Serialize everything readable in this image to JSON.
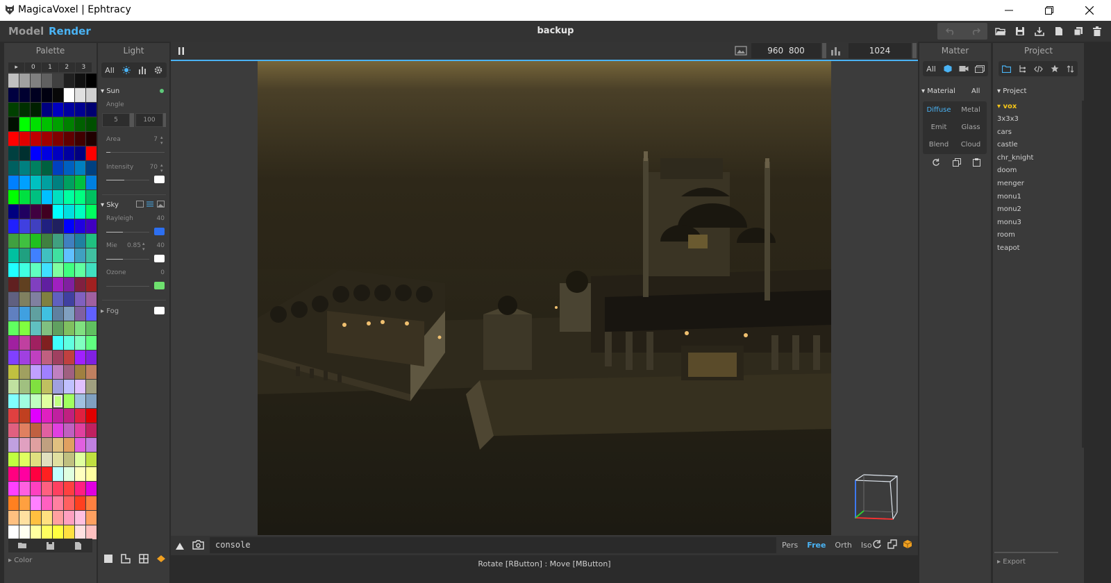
{
  "window": {
    "title": "MagicaVoxel | Ephtracy",
    "minimize_icon": "minimize-icon",
    "restore_icon": "restore-icon",
    "close_icon": "close-icon"
  },
  "menubar": {
    "mode_model": "Model",
    "mode_render": "Render",
    "filename": "backup"
  },
  "palette": {
    "title": "Palette",
    "tabs": [
      "▸",
      "0",
      "1",
      "2",
      "3"
    ],
    "colors": [
      "#c0c0c0",
      "#a0a0a0",
      "#808080",
      "#606060",
      "#404040",
      "#202020",
      "#101010",
      "#000000",
      "#000040",
      "#000030",
      "#000020",
      "#000010",
      "#080808",
      "#ffffff",
      "#e0e0e0",
      "#d0d0d0",
      "#004000",
      "#003000",
      "#002000",
      "#000080",
      "#0000c0",
      "#0000a0",
      "#000090",
      "#000070",
      "#001000",
      "#00ff00",
      "#00e000",
      "#00c000",
      "#00a000",
      "#008000",
      "#006000",
      "#005000",
      "#ff0000",
      "#e00000",
      "#c00000",
      "#a00000",
      "#800000",
      "#600000",
      "#400000",
      "#200000",
      "#004040",
      "#003030",
      "#0000ff",
      "#0000e0",
      "#0000c0",
      "#0000a0",
      "#000080",
      "#ff0000",
      "#006060",
      "#008080",
      "#008060",
      "#006040",
      "#0040c0",
      "#0060c0",
      "#0080c0",
      "#004080",
      "#0080ff",
      "#00a0ff",
      "#00c0c0",
      "#00a0a0",
      "#008080",
      "#00a060",
      "#00c040",
      "#0080e0",
      "#00ff00",
      "#00e040",
      "#00c080",
      "#00c0ff",
      "#00e0c0",
      "#00ffa0",
      "#00ff80",
      "#00c060",
      "#000080",
      "#200060",
      "#400040",
      "#400020",
      "#00ffff",
      "#00e0e0",
      "#00ffc0",
      "#00ff60",
      "#2020ff",
      "#4040e0",
      "#4040c0",
      "#202080",
      "#202060",
      "#0000ff",
      "#2000e0",
      "#4000c0",
      "#40a040",
      "#40c040",
      "#20c020",
      "#408040",
      "#40a080",
      "#4080c0",
      "#2080a0",
      "#20c080",
      "#00c0a0",
      "#20a080",
      "#4080ff",
      "#40c0c0",
      "#40e0a0",
      "#60c0ff",
      "#40a0c0",
      "#40c0a0",
      "#20ffff",
      "#40ffe0",
      "#60ffc0",
      "#40e0ff",
      "#80ffa0",
      "#40ff80",
      "#60ffa0",
      "#40e0c0",
      "#602020",
      "#604020",
      "#8040c0",
      "#6020a0",
      "#a020c0",
      "#8020a0",
      "#802040",
      "#a02020",
      "#606080",
      "#808060",
      "#8080a0",
      "#808040",
      "#6060c0",
      "#4040a0",
      "#8060c0",
      "#a060a0",
      "#6080c0",
      "#40a0e0",
      "#60a0a0",
      "#40c0e0",
      "#6080a0",
      "#80a0c0",
      "#8060a0",
      "#6060ff",
      "#60ff60",
      "#80ff40",
      "#60c0c0",
      "#80c080",
      "#60a060",
      "#80c060",
      "#80e080",
      "#60c060",
      "#a020a0",
      "#c040a0",
      "#a02060",
      "#802020",
      "#40ffff",
      "#60ffe0",
      "#80ffc0",
      "#60ff80",
      "#8040ff",
      "#a040e0",
      "#c040c0",
      "#c06080",
      "#a04060",
      "#c04040",
      "#a020ff",
      "#8020e0",
      "#c0c040",
      "#a0a060",
      "#c0a0ff",
      "#a080ff",
      "#c080c0",
      "#a06080",
      "#a08040",
      "#c08060",
      "#c0e0a0",
      "#a0c080",
      "#80e040",
      "#c0c060",
      "#a0a0e0",
      "#c0c0ff",
      "#e0c0ff",
      "#a0a080",
      "#80ffff",
      "#a0ffe0",
      "#c0ffc0",
      "#e0ffa0",
      "#c0ff80",
      "#a0ff60",
      "#a0c0e0",
      "#80a0c0",
      "#e04040",
      "#c04020",
      "#e000ff",
      "#e020c0",
      "#c020a0",
      "#c02080",
      "#e02040",
      "#e00000",
      "#e06080",
      "#e08060",
      "#c06040",
      "#e060a0",
      "#e040e0",
      "#c060c0",
      "#e040a0",
      "#c02060",
      "#c0a0e0",
      "#e0a0c0",
      "#e0a0a0",
      "#c0a080",
      "#e0c080",
      "#e0a060",
      "#e060e0",
      "#c080e0",
      "#c0ff40",
      "#e0ff60",
      "#e0e080",
      "#e0e0c0",
      "#e0e0a0",
      "#c0c080",
      "#e0ffa0",
      "#c0e040",
      "#ff0080",
      "#ff00a0",
      "#ff0040",
      "#ff2020",
      "#c0ffff",
      "#e0ffe0",
      "#ffffc0",
      "#ffffa0",
      "#ff40ff",
      "#ff60e0",
      "#ff40c0",
      "#ff6080",
      "#ff4060",
      "#ff4040",
      "#ff2080",
      "#e000e0",
      "#ff8020",
      "#ffa040",
      "#ff80ff",
      "#ff60c0",
      "#ff80a0",
      "#ff6060",
      "#ff4020",
      "#ff8040",
      "#ffc080",
      "#ffe0a0",
      "#ffc040",
      "#ffe080",
      "#ffa0a0",
      "#ffa0c0",
      "#ffc0e0",
      "#ffa060",
      "#ffffff",
      "#fffff0",
      "#ffffa0",
      "#ffff60",
      "#ffff40",
      "#ffe040",
      "#ffe0e0",
      "#ffc0c0"
    ],
    "selected_index": 180,
    "bottom_icons": [
      "folder-open-icon",
      "save-icon",
      "new-file-icon"
    ],
    "color_label": "Color",
    "tools": [
      "box-tool-icon",
      "corner-tool-icon",
      "grid-tool-icon",
      "diamond-tool-icon"
    ]
  },
  "light": {
    "title": "Light",
    "tabs_all": "All",
    "tab_icons": [
      "sun-icon",
      "bar-chart-icon",
      "gear-icon"
    ],
    "sun": {
      "label": "Sun",
      "angle_label": "Angle",
      "angle_1": "5",
      "angle_2": "100",
      "area_label": "Area",
      "area_value": "7",
      "intensity_label": "Intensity",
      "intensity_value": "70",
      "intensity_level": 0.7
    },
    "sky": {
      "label": "Sky",
      "rayleigh_label": "Rayleigh",
      "rayleigh_value": "40",
      "rayleigh_color": "#2d6ff0",
      "mie_label": "Mie",
      "mie_value_1": "0.85",
      "mie_value_2": "40",
      "ozone_label": "Ozone",
      "ozone_value": "0",
      "ozone_color": "#6ee06e"
    },
    "fog": {
      "label": "Fog"
    }
  },
  "viewport": {
    "width": "960",
    "height": "800",
    "samples": "1024",
    "console_placeholder": "console",
    "views": [
      "Pers",
      "Free",
      "Orth",
      "Iso"
    ],
    "active_view": "Free",
    "status": "Rotate [RButton] : Move [MButton]"
  },
  "matter": {
    "title": "Matter",
    "tabs_all": "All",
    "material_label": "Material",
    "material_all": "All",
    "materials": [
      "Diffuse",
      "Metal",
      "Emit",
      "Glass",
      "Blend",
      "Cloud"
    ],
    "active_material": "Diffuse"
  },
  "project": {
    "title": "Project",
    "section_label": "Project",
    "folder": "vox",
    "items": [
      "3x3x3",
      "cars",
      "castle",
      "chr_knight",
      "doom",
      "menger",
      "monu1",
      "monu2",
      "monu3",
      "room",
      "teapot"
    ],
    "export_label": "Export"
  },
  "colors": {
    "accent": "#4ab3f4",
    "folder_highlight": "#f5c518",
    "sun_status": "#5ec97a"
  }
}
